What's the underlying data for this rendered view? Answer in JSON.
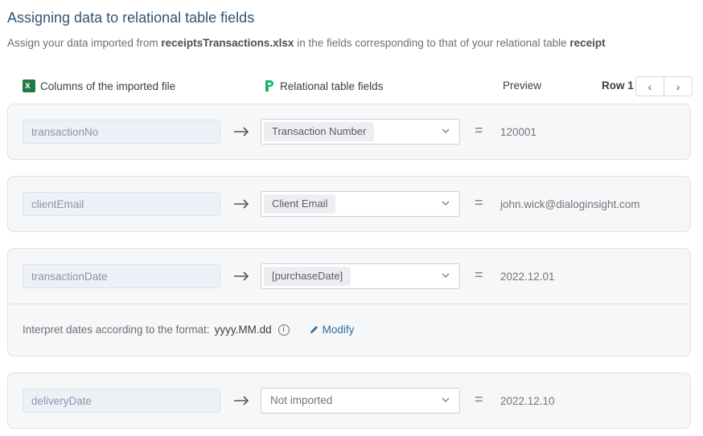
{
  "page": {
    "title": "Assigning data to relational table fields",
    "subtitle_pre": "Assign your data imported from ",
    "file_name": "receiptsTransactions.xlsx",
    "subtitle_mid": " in the fields corresponding to that of your relational table ",
    "table_name": "receipt"
  },
  "headers": {
    "columns_label": "Columns of the imported file",
    "columns_icon": "excel-icon",
    "fields_label": "Relational table fields",
    "fields_icon": "relational-table-icon",
    "preview_label": "Preview",
    "row_label": "Row 1",
    "prev_symbol": "‹",
    "next_symbol": "›"
  },
  "rows": [
    {
      "source": "transactionNo",
      "field": "Transaction Number",
      "preview": "120001"
    },
    {
      "source": "clientEmail",
      "field": "Client Email",
      "preview": "john.wick@dialoginsight.com"
    },
    {
      "source": "transactionDate",
      "field": "[purchaseDate]",
      "preview": "2022.12.01"
    },
    {
      "source": "deliveryDate",
      "field": "Not imported",
      "preview": "2022.12.10"
    }
  ],
  "date_format": {
    "label": "Interpret dates according to the format:",
    "value": "yyyy.MM.dd",
    "info_symbol": "i",
    "modify_label": "Modify"
  },
  "symbols": {
    "equals": "="
  },
  "colors": {
    "title": "#2e5575",
    "link": "#2f6da3",
    "excel_green": "#1f7a45",
    "relational_green": "#19b36b"
  }
}
